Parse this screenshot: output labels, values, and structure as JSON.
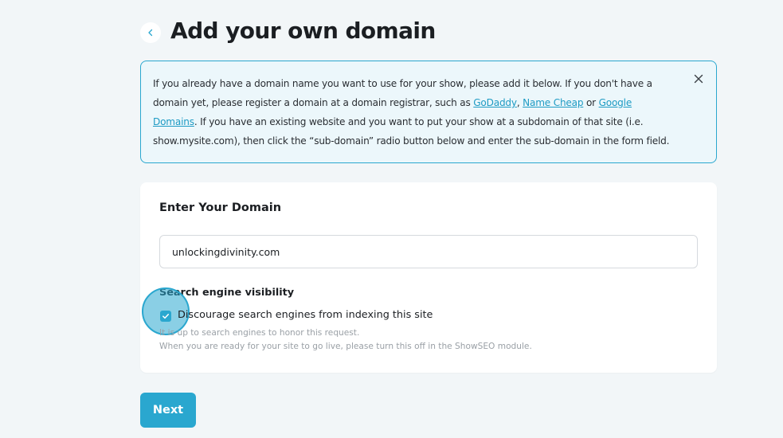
{
  "header": {
    "title": "Add your own domain",
    "back_icon": "chevron-left-icon"
  },
  "info": {
    "text_1": "If you already have a domain name you want to use for your show, please add it below. If you don't have a domain yet, please register a domain at a domain registrar, such as ",
    "link_godaddy": "GoDaddy",
    "sep_1": ", ",
    "link_namecheap": "Name Cheap",
    "sep_2": " or ",
    "link_google": "Google Domains",
    "text_2": ". If you have an existing website and you want to put your show at a subdomain of that site (i.e. show.mysite.com), then click the “sub-domain” radio button below and enter the sub-domain in the form field.",
    "close_icon": "close-icon"
  },
  "form": {
    "title": "Enter Your Domain",
    "domain_value": "unlockingdivinity.com",
    "visibility_label": "Search engine visibility",
    "checkbox_label": "Discourage search engines from indexing this site",
    "checkbox_checked": true,
    "help_line_1": "It is up to search engines to honor this request.",
    "help_line_2": "When you are ready for your site to go live, please turn this off in the ShowSEO module."
  },
  "actions": {
    "next_label": "Next"
  },
  "colors": {
    "accent": "#2aa7cf",
    "info_bg": "#ecf7fb",
    "page_bg": "#f2f6f8"
  }
}
